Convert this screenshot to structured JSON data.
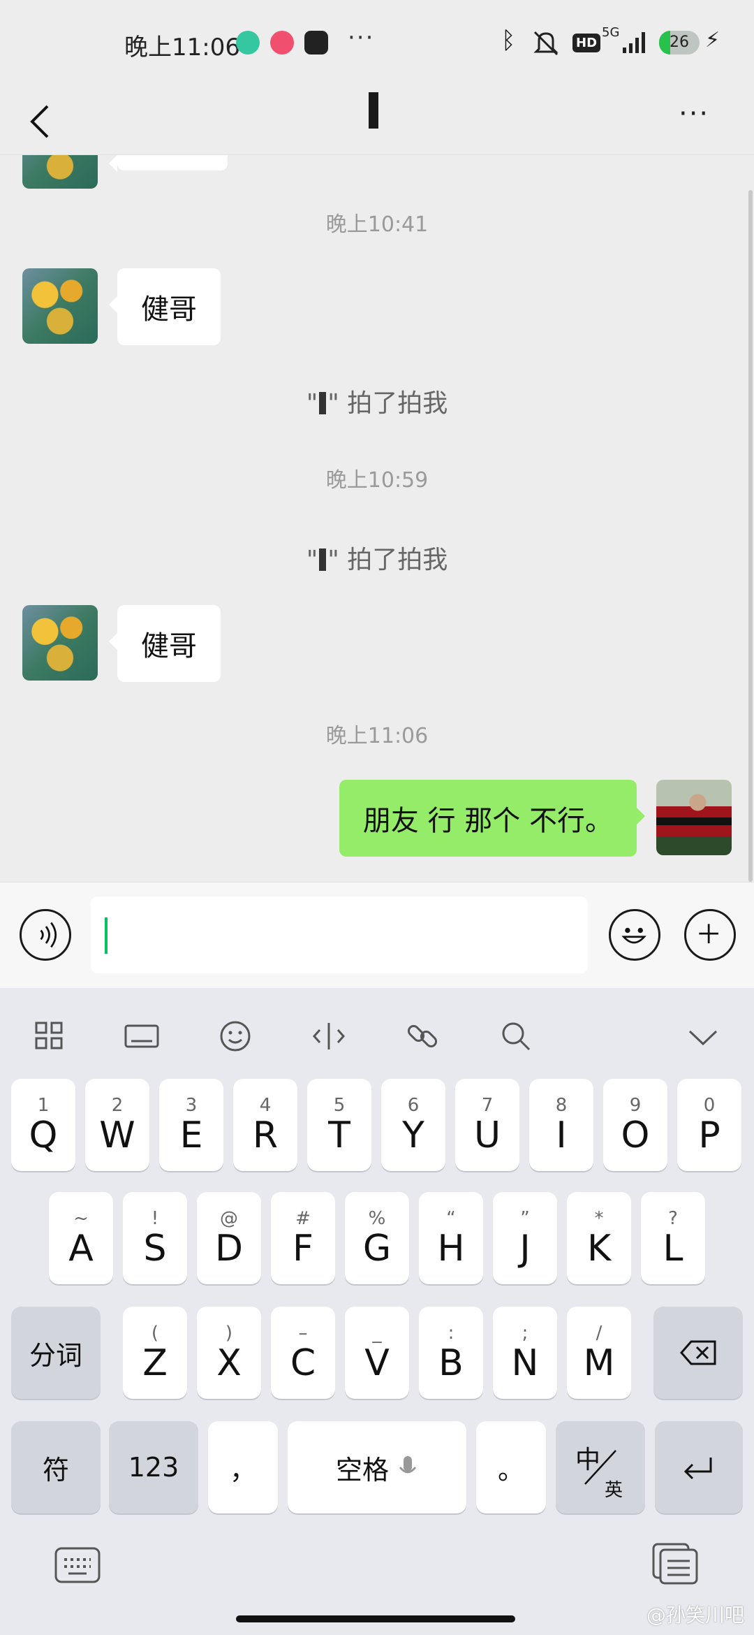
{
  "status_bar": {
    "time": "晚上11:06",
    "app_icons": [
      "android-icon",
      "red-badge-icon",
      "owl-icon"
    ],
    "more": "···",
    "network": "5G",
    "hd": "HD",
    "battery": "26"
  },
  "header": {
    "back_icon": "chevron-left-icon",
    "more_icon": "more-icon",
    "more": "···"
  },
  "messages": [
    {
      "type": "timestamp",
      "text": "晚上10:41"
    },
    {
      "type": "incoming",
      "text": "健哥"
    },
    {
      "type": "system",
      "prefix": "\"",
      "suffix": "\" 拍了拍我"
    },
    {
      "type": "timestamp",
      "text": "晚上10:59"
    },
    {
      "type": "system",
      "prefix": "\"",
      "suffix": "\" 拍了拍我"
    },
    {
      "type": "incoming",
      "text": "健哥"
    },
    {
      "type": "timestamp",
      "text": "晚上11:06"
    },
    {
      "type": "outgoing",
      "text": "朋友 行   那个 不行。"
    }
  ],
  "input": {
    "voice_icon": "voice-icon",
    "emoji_icon": "emoji-icon",
    "plus_icon": "plus-icon"
  },
  "keyboard": {
    "toolbar": [
      "grid-icon",
      "keyboard-icon",
      "smile-icon",
      "cursor-icon",
      "link-icon",
      "search-icon",
      "chevron-down-icon"
    ],
    "row1": [
      {
        "sym": "1",
        "key": "Q"
      },
      {
        "sym": "2",
        "key": "W"
      },
      {
        "sym": "3",
        "key": "E"
      },
      {
        "sym": "4",
        "key": "R"
      },
      {
        "sym": "5",
        "key": "T"
      },
      {
        "sym": "6",
        "key": "Y"
      },
      {
        "sym": "7",
        "key": "U"
      },
      {
        "sym": "8",
        "key": "I"
      },
      {
        "sym": "9",
        "key": "O"
      },
      {
        "sym": "0",
        "key": "P"
      }
    ],
    "row2": [
      {
        "sym": "~",
        "key": "A"
      },
      {
        "sym": "!",
        "key": "S"
      },
      {
        "sym": "@",
        "key": "D"
      },
      {
        "sym": "#",
        "key": "F"
      },
      {
        "sym": "%",
        "key": "G"
      },
      {
        "sym": "“",
        "key": "H"
      },
      {
        "sym": "”",
        "key": "J"
      },
      {
        "sym": "*",
        "key": "K"
      },
      {
        "sym": "?",
        "key": "L"
      }
    ],
    "row3_left": "分词",
    "row3": [
      {
        "sym": "(",
        "key": "Z"
      },
      {
        "sym": ")",
        "key": "X"
      },
      {
        "sym": "–",
        "key": "C"
      },
      {
        "sym": "_",
        "key": "V"
      },
      {
        "sym": ":",
        "key": "B"
      },
      {
        "sym": ";",
        "key": "N"
      },
      {
        "sym": "/",
        "key": "M"
      }
    ],
    "row3_right_icon": "backspace-icon",
    "row4": {
      "symbols": "符",
      "numbers": "123",
      "comma": "，",
      "space": "空格",
      "period": "。",
      "lang_top": "中",
      "lang_bottom": "英",
      "enter_icon": "enter-icon"
    },
    "bottom_left_icon": "keyboard-switch-icon",
    "bottom_right_icon": "clipboard-icon"
  },
  "watermark": "@孙笑川吧"
}
